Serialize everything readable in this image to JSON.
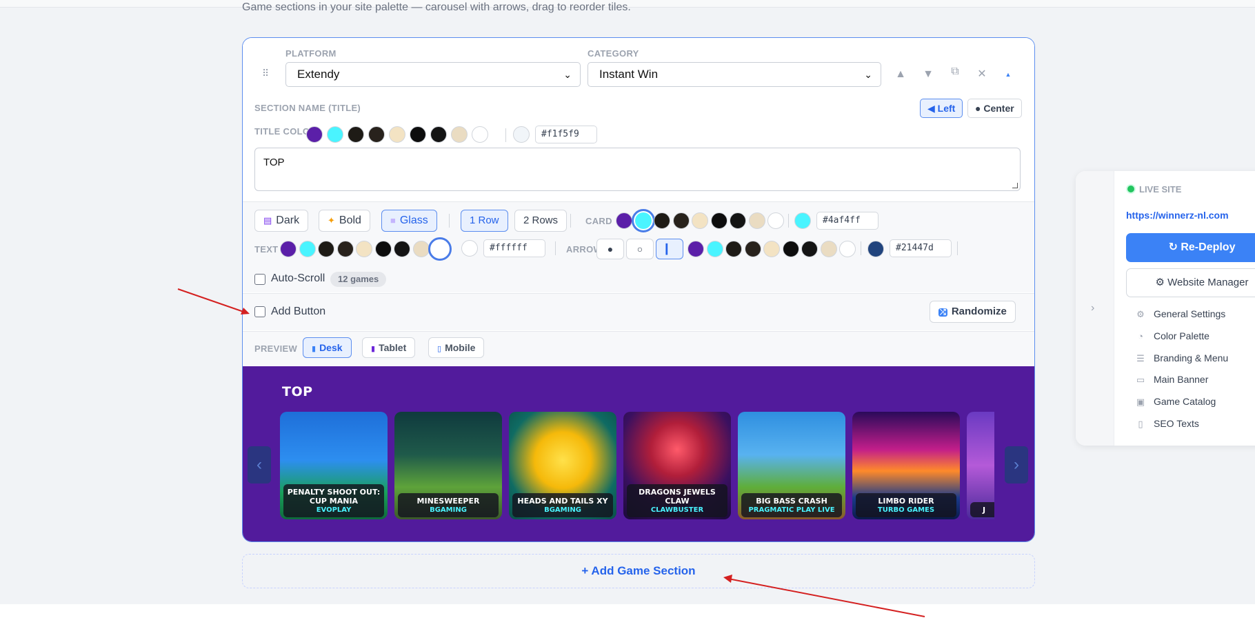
{
  "subtitle": "Game sections in your site palette — carousel with arrows, drag to reorder tiles.",
  "section": {
    "platform_label": "PLATFORM",
    "platform_value": "Extendy",
    "category_label": "CATEGORY",
    "category_value": "Instant Win",
    "name_label": "SECTION NAME (TITLE)",
    "align_left": "◀ Left",
    "align_center": "● Center",
    "title_color_label": "TITLE COLOR",
    "title_color_hex": "#f1f5f9",
    "title_value": "TOP",
    "style_buttons": [
      {
        "icon": "🀫",
        "label": "Dark"
      },
      {
        "icon": "✨",
        "label": "Bold"
      },
      {
        "icon": "▭",
        "label": "Glass"
      }
    ],
    "rows_buttons": [
      "1 Row",
      "2 Rows"
    ],
    "card_label": "CARD",
    "card_hex": "#4af4ff",
    "text_label": "TEXT",
    "text_hex": "#ffffff",
    "arrow_label": "ARROW",
    "arrow_hex": "#21447d",
    "arrow_styles": [
      "●",
      "○",
      "▎"
    ],
    "autoscroll_label": "Auto-Scroll",
    "games_count": "12 games",
    "add_button_label": "Add Button",
    "randomize_label": "Randomize",
    "preview_label": "PREVIEW",
    "preview_buttons": [
      "Desk",
      "Tablet",
      "Mobile"
    ],
    "preview_title": "TOP",
    "games": [
      {
        "name": "PENALTY SHOOT OUT: CUP MANIA",
        "provider": "EVOPLAY"
      },
      {
        "name": "MINESWEEPER",
        "provider": "BGAMING"
      },
      {
        "name": "HEADS AND TAILS XY",
        "provider": "BGAMING"
      },
      {
        "name": "DRAGONS JEWELS CLAW",
        "provider": "CLAWBUSTER"
      },
      {
        "name": "BIG BASS CRASH",
        "provider": "PRAGMATIC PLAY LIVE"
      },
      {
        "name": "LIMBO RIDER",
        "provider": "TURBO GAMES"
      },
      {
        "name": "J",
        "provider": ""
      }
    ]
  },
  "add_section_label": "+ Add Game Section",
  "panel": {
    "live_label": "LIVE SITE",
    "url": "https://winnerz-nl.com",
    "deploy_label": "↻ Re-Deploy",
    "manager_label": "⚙ Website Manager",
    "menu": [
      {
        "icon": "gear-icon",
        "label": "General Settings"
      },
      {
        "icon": "palette-icon",
        "label": "Color Palette"
      },
      {
        "icon": "menu-icon",
        "label": "Branding & Menu"
      },
      {
        "icon": "banner-icon",
        "label": "Main Banner"
      },
      {
        "icon": "catalog-icon",
        "label": "Game Catalog"
      },
      {
        "icon": "document-icon",
        "label": "SEO Texts"
      }
    ]
  },
  "colors": {
    "accent": "#3b82f6",
    "preview_bg": "#521b9c",
    "card": "#4af4ff",
    "arrow": "#21447d",
    "title_color_swatches": [
      "#5b1fa8",
      "#4af4ff",
      "#1e1b16",
      "#28221c",
      "#f3e3c3",
      "#0d0d0d",
      "#141414",
      "#eadcc2",
      "#ffffff"
    ],
    "title_color_custom": "#f1f5f9",
    "card_swatches": [
      "#5b1fa8",
      "#4af4ff",
      "#1e1b16",
      "#28221c",
      "#f3e3c3",
      "#0d0d0d",
      "#141414",
      "#eadcc2",
      "#ffffff"
    ],
    "text_swatches": [
      "#5b1fa8",
      "#4af4ff",
      "#1e1b16",
      "#28221c",
      "#f3e3c3",
      "#0d0d0d",
      "#141414",
      "#eadcc2",
      "#ffffff"
    ],
    "text_custom": "#ffffff",
    "arrow_swatches": [
      "#5b1fa8",
      "#4af4ff",
      "#1e1b16",
      "#28221c",
      "#f3e3c3",
      "#0d0d0d",
      "#141414",
      "#eadcc2",
      "#ffffff"
    ]
  }
}
